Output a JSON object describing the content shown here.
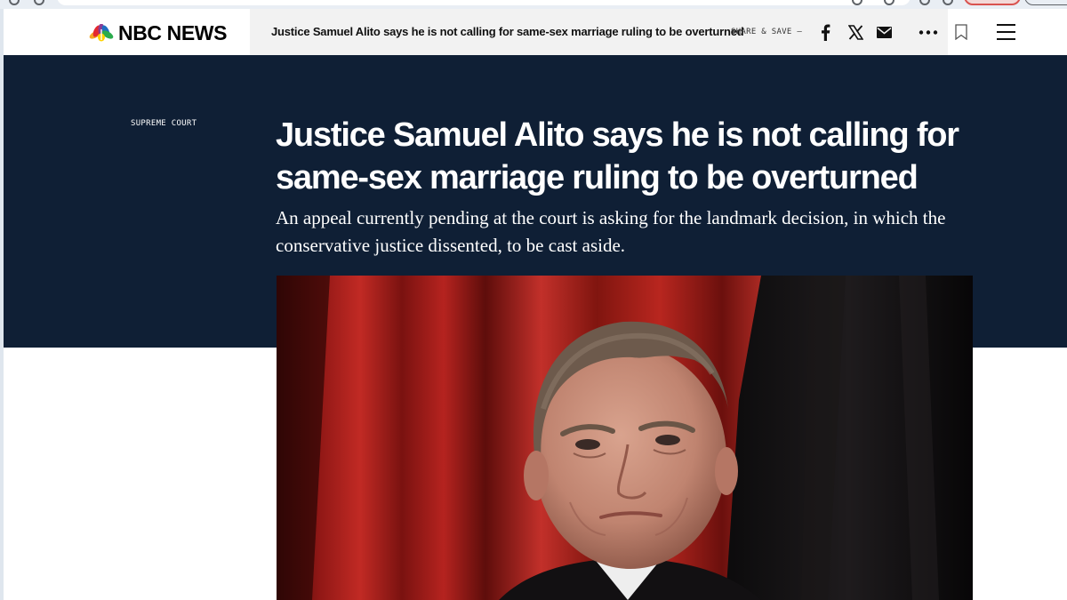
{
  "header": {
    "logo_text": "NBC NEWS",
    "article_title": "Justice Samuel Alito says he is not calling for same-sex marriage ruling to be overturned",
    "share_label": "SHARE & SAVE —",
    "icons": [
      "facebook-icon",
      "x-icon",
      "mail-icon",
      "more-icon",
      "bookmark-icon",
      "menu-icon"
    ]
  },
  "article": {
    "section_label": "SUPREME COURT",
    "headline": "Justice Samuel Alito says he is not calling for same-sex marriage ruling to be overturned",
    "dek": "An appeal currently pending at the court is asking for the landmark decision, in which the conservative justice dissented, to be cast aside."
  },
  "colors": {
    "hero_background": "#0f1f35",
    "header_strip": "#f2f2f2",
    "curtain_red": "#b0201e"
  }
}
